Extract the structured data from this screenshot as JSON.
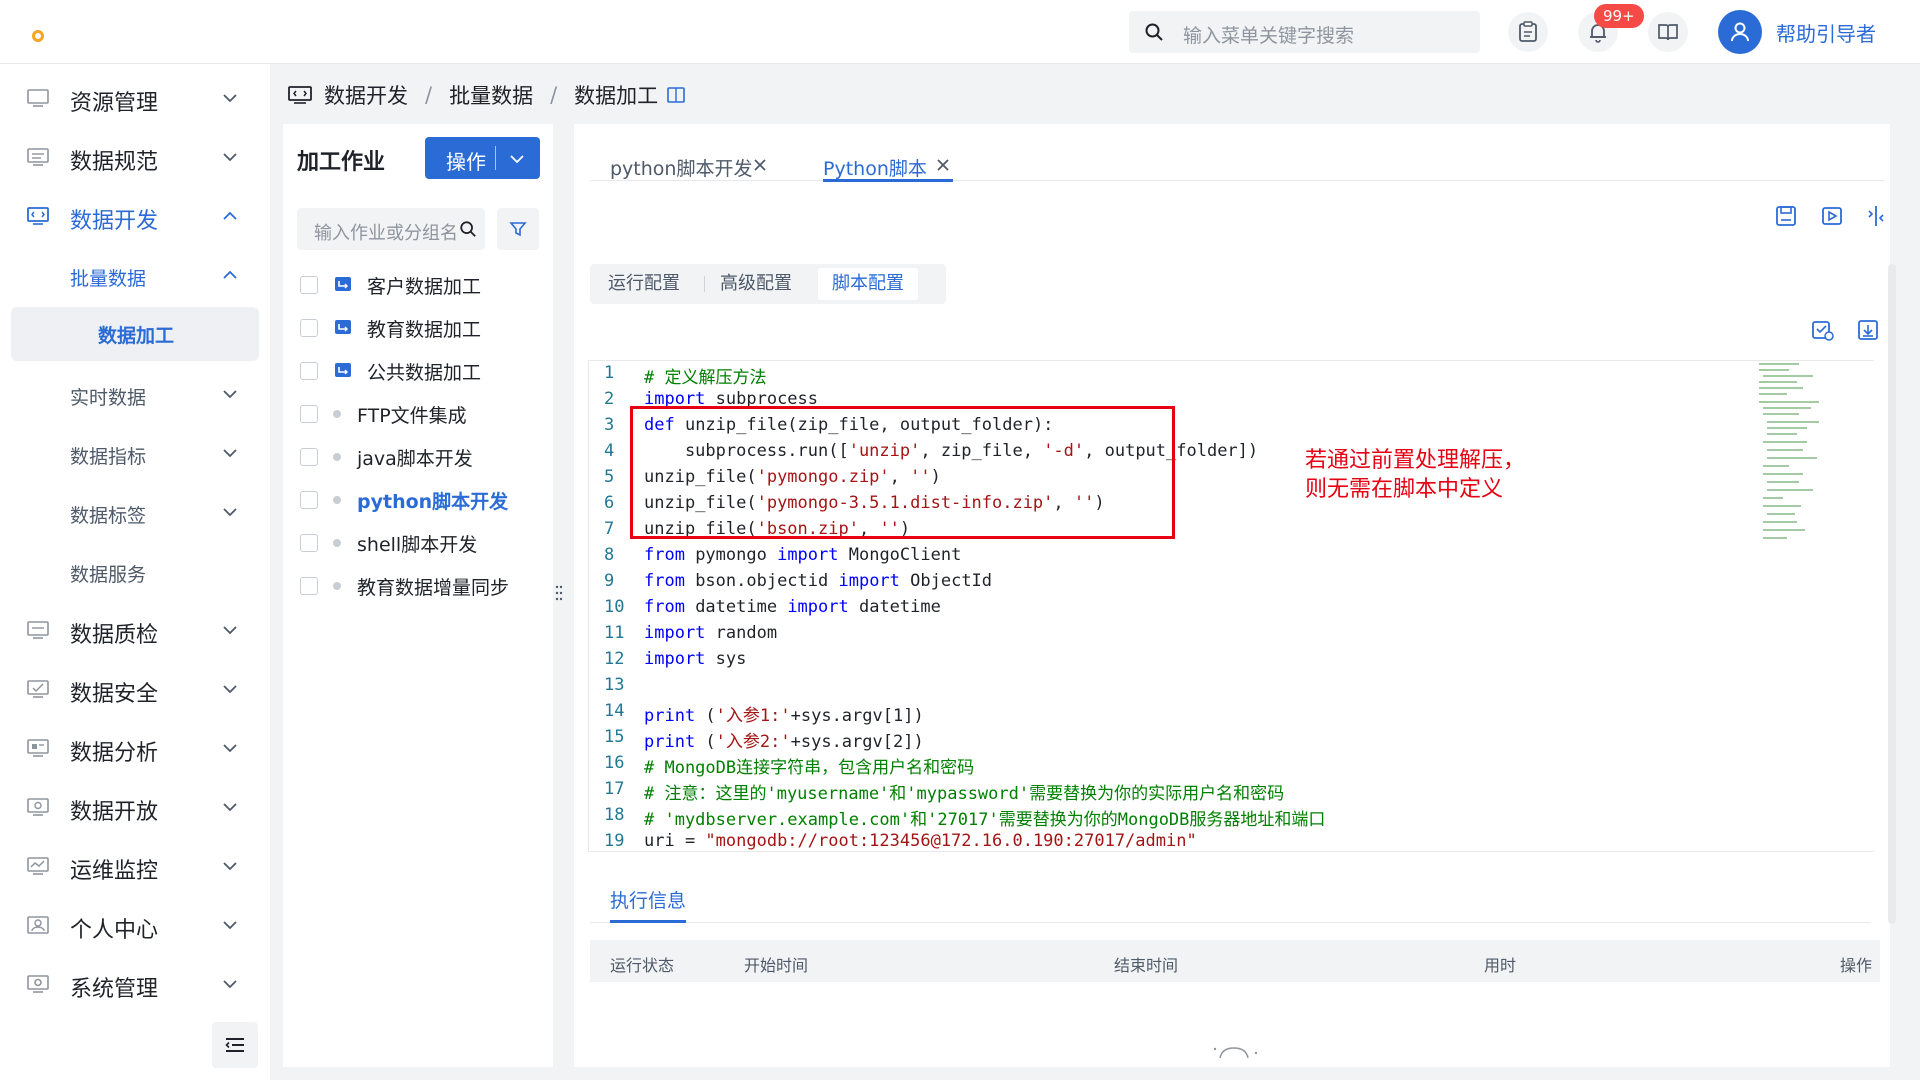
{
  "header": {
    "search_placeholder": "输入菜单关键字搜索",
    "notification_badge": "99+",
    "help_label": "帮助引导者"
  },
  "sidebar": {
    "items": [
      {
        "label": "资源管理",
        "icon": "resource-icon"
      },
      {
        "label": "数据规范",
        "icon": "spec-icon"
      },
      {
        "label": "数据开发",
        "icon": "dev-icon",
        "expanded": true
      },
      {
        "label": "数据质检",
        "icon": "quality-icon"
      },
      {
        "label": "数据安全",
        "icon": "security-icon"
      },
      {
        "label": "数据分析",
        "icon": "analysis-icon"
      },
      {
        "label": "数据开放",
        "icon": "open-icon"
      },
      {
        "label": "运维监控",
        "icon": "monitor-icon"
      },
      {
        "label": "个人中心",
        "icon": "user-icon"
      },
      {
        "label": "系统管理",
        "icon": "system-icon"
      }
    ],
    "sub_items": [
      {
        "label": "批量数据",
        "expanded": true
      },
      {
        "label": "数据加工",
        "selected": true
      },
      {
        "label": "实时数据"
      },
      {
        "label": "数据指标"
      },
      {
        "label": "数据标签"
      },
      {
        "label": "数据服务"
      }
    ]
  },
  "breadcrumb": [
    "数据开发",
    "批量数据",
    "数据加工"
  ],
  "job_panel": {
    "title": "加工作业",
    "op_button": "操作",
    "search_placeholder": "输入作业或分组名",
    "jobs": [
      {
        "label": "客户数据加工",
        "type": "folder"
      },
      {
        "label": "教育数据加工",
        "type": "folder"
      },
      {
        "label": "公共数据加工",
        "type": "folder"
      },
      {
        "label": "FTP文件集成",
        "type": "job"
      },
      {
        "label": "java脚本开发",
        "type": "job"
      },
      {
        "label": "python脚本开发",
        "type": "job",
        "selected": true
      },
      {
        "label": "shell脚本开发",
        "type": "job"
      },
      {
        "label": "教育数据增量同步",
        "type": "job"
      }
    ]
  },
  "tabs": [
    {
      "label": "python脚本开发",
      "active": false
    },
    {
      "label": "Python脚本",
      "active": true
    }
  ],
  "config_tabs": [
    {
      "label": "运行配置",
      "active": false
    },
    {
      "label": "高级配置",
      "active": false
    },
    {
      "label": "脚本配置",
      "active": true
    }
  ],
  "code_lines": [
    "1",
    "2",
    "3",
    "4",
    "5",
    "6",
    "7",
    "8",
    "9",
    "10",
    "11",
    "12",
    "13",
    "14",
    "15",
    "16",
    "17",
    "18",
    "19"
  ],
  "code": {
    "l1": "# 定义解压方法",
    "l2_kw": "import",
    "l2_rest": " subprocess",
    "l3_kw": "def",
    "l3_rest": " unzip_file(zip_file, output_folder):",
    "l4_a": "    subprocess.run([",
    "l4_s1": "'unzip'",
    "l4_b": ", zip_file, ",
    "l4_s2": "'-d'",
    "l4_c": ", output_folder])",
    "l5_a": "unzip_file(",
    "l5_s1": "'pymongo.zip'",
    "l5_b": ", ",
    "l5_s2": "''",
    "l5_c": ")",
    "l6_a": "unzip_file(",
    "l6_s1": "'pymongo-3.5.1.dist-info.zip'",
    "l6_b": ", ",
    "l6_s2": "''",
    "l6_c": ")",
    "l7_a": "unzip_file(",
    "l7_s1": "'bson.zip'",
    "l7_b": ", ",
    "l7_s2": "''",
    "l7_c": ")",
    "l8_kw1": "from",
    "l8_a": " pymongo ",
    "l8_kw2": "import",
    "l8_b": " MongoClient",
    "l9_kw1": "from",
    "l9_a": " bson.objectid ",
    "l9_kw2": "import",
    "l9_b": " ObjectId",
    "l10_kw1": "from",
    "l10_a": " datetime ",
    "l10_kw2": "import",
    "l10_b": " datetime",
    "l11_kw": "import",
    "l11_rest": " random",
    "l12_kw": "import",
    "l12_rest": " sys",
    "l14_kw": "print",
    "l14_a": " (",
    "l14_s": "'入参1:'",
    "l14_b": "+sys.argv[1])",
    "l15_kw": "print",
    "l15_a": " (",
    "l15_s": "'入参2:'",
    "l15_b": "+sys.argv[2])",
    "l16": "# MongoDB连接字符串，包含用户名和密码",
    "l17": "# 注意：这里的'myusername'和'mypassword'需要替换为你的实际用户名和密码",
    "l18": "# 'mydbserver.example.com'和'27017'需要替换为你的MongoDB服务器地址和端口",
    "l19_a": "uri = ",
    "l19_s": "\"mongodb://root:123456@172.16.0.190:27017/admin\""
  },
  "annotation": {
    "line1": "若通过前置处理解压，",
    "line2": "则无需在脚本中定义"
  },
  "exec": {
    "tab_label": "执行信息",
    "columns": [
      "运行状态",
      "开始时间",
      "结束时间",
      "用时",
      "操作"
    ]
  },
  "colors": {
    "accent": "#2b6bd6",
    "annotation_red": "#e60012",
    "badge_red": "#f54a45"
  }
}
